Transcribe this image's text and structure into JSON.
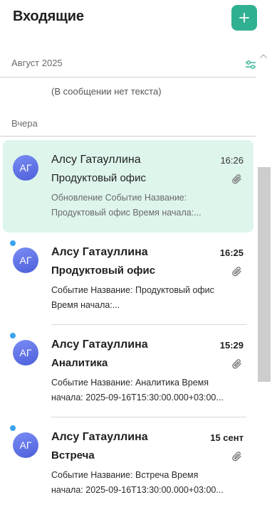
{
  "header": {
    "title": "Входящие",
    "compose_label": "+"
  },
  "groups": {
    "august": "Август 2025",
    "yesterday": "Вчера"
  },
  "no_text_message": "(В сообщении нет текста)",
  "messages": [
    {
      "avatar": "АГ",
      "sender": "Алсу Гатауллина",
      "time": "16:26",
      "subject": "Продуктовый офис",
      "preview_line1": "Обновление Событие Название:",
      "preview_line2": "Продуктовый офис Время начала:...",
      "selected": true,
      "unread": false,
      "has_attachment": true
    },
    {
      "avatar": "АГ",
      "sender": "Алсу Гатауллина",
      "time": "16:25",
      "subject": "Продуктовый офис",
      "preview_line1": "Событие Название: Продуктовый офис",
      "preview_line2": "Время начала:...",
      "selected": false,
      "unread": true,
      "has_attachment": true
    },
    {
      "avatar": "АГ",
      "sender": "Алсу Гатауллина",
      "time": "15:29",
      "subject": "Аналитика",
      "preview_line1": "Событие Название: Аналитика Время",
      "preview_line2": "начала: 2025-09-16T15:30:00.000+03:00...",
      "selected": false,
      "unread": true,
      "has_attachment": true
    },
    {
      "avatar": "АГ",
      "sender": "Алсу Гатауллина",
      "time": "15 сент",
      "subject": "Встреча",
      "preview_line1": "Событие Название: Встреча Время",
      "preview_line2": "начала: 2025-09-16T13:30:00.000+03:00...",
      "selected": false,
      "unread": true,
      "has_attachment": true
    }
  ],
  "colors": {
    "accent": "#2fb191",
    "selected_bg": "#def5ec",
    "unread_dot": "#3aa3f0",
    "avatar": "#5b6ee6"
  },
  "icons": {
    "compose": "plus-icon",
    "filter": "filter-sliders-icon",
    "attachment": "paperclip-icon",
    "scroll_up": "chevron-up-icon"
  }
}
